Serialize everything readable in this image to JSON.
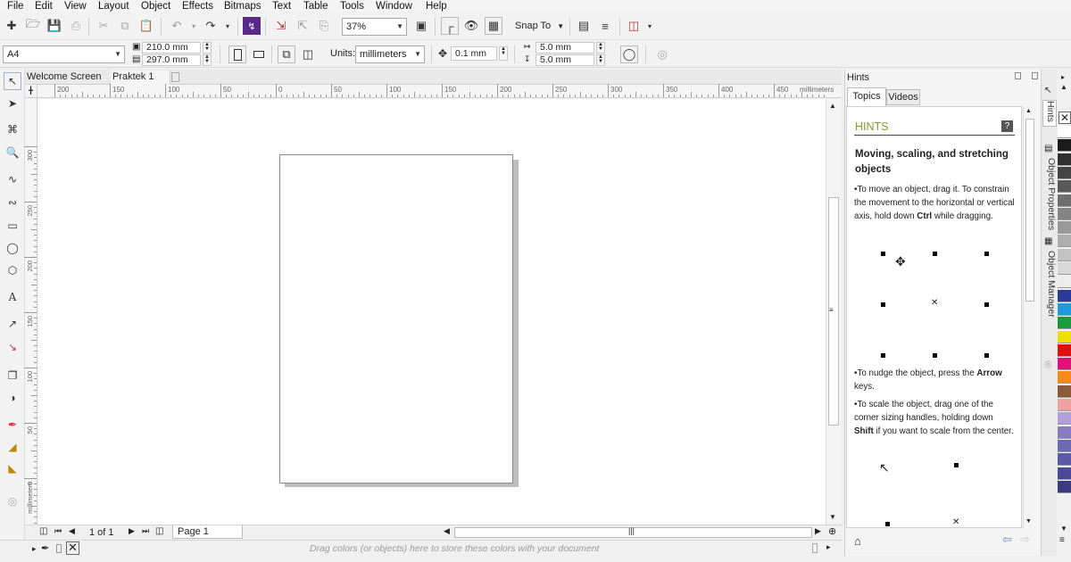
{
  "menu": [
    "File",
    "Edit",
    "View",
    "Layout",
    "Object",
    "Effects",
    "Bitmaps",
    "Text",
    "Table",
    "Tools",
    "Window",
    "Help"
  ],
  "toolbar": {
    "zoom": "37%",
    "snap_to": "Snap To"
  },
  "property_bar": {
    "paper": "A4",
    "width": "210.0 mm",
    "height": "297.0 mm",
    "units_label": "Units:",
    "units": "millimeters",
    "nudge": "0.1 mm",
    "dup_x": "5.0 mm",
    "dup_y": "5.0 mm"
  },
  "doc_tabs": [
    "Welcome Screen",
    "Praktek 1"
  ],
  "ruler": {
    "h_ticks": [
      "200",
      "150",
      "100",
      "50",
      "0",
      "50",
      "100",
      "150",
      "200",
      "250",
      "300",
      "350",
      "400",
      "450"
    ],
    "h_units": "millimeters",
    "v_ticks": [
      "300",
      "250",
      "200",
      "150",
      "100",
      "50",
      "0"
    ],
    "v_units": "millimeters"
  },
  "page_nav": {
    "count": "1 of 1",
    "page_tab": "Page 1"
  },
  "status": {
    "hint": "Drag colors (or objects) here to store these colors with your document"
  },
  "hints_panel": {
    "title": "Hints",
    "tabs": [
      "Topics",
      "Videos"
    ],
    "heading": "HINTS",
    "topic_title": "Moving, scaling, and stretching objects",
    "para1_a": "To move an object, drag it. To constrain the movement to the horizontal or vertical axis, hold down ",
    "para1_bold": "Ctrl",
    "para1_b": " while dragging.",
    "para2_a": "To nudge the object, press the ",
    "para2_bold": "Arrow",
    "para2_b": " keys.",
    "para3_a": "To scale the object, drag one of the corner sizing handles, holding down ",
    "para3_bold": "Shift",
    "para3_b": " if you want to scale from the center."
  },
  "docker_tabs": [
    "Hints",
    "Object Properties",
    "Object Manager"
  ],
  "palette_colors": [
    "#ffffff",
    "#1a1a1a",
    "#2f2f2f",
    "#444444",
    "#595959",
    "#6e6e6e",
    "#838383",
    "#989898",
    "#adadad",
    "#c2c2c2",
    "#d7d7d7",
    "#ececec",
    "#2a3a9a",
    "#1e9bdc",
    "#1a9a3a",
    "#f0e000",
    "#e01010",
    "#e0107a",
    "#f58a1a",
    "#8a5a3a",
    "#f0a0a0",
    "#b0a0d8",
    "#8a7ac0",
    "#6a6ab0",
    "#5a5aa8",
    "#4a4a98",
    "#3a3a80"
  ]
}
